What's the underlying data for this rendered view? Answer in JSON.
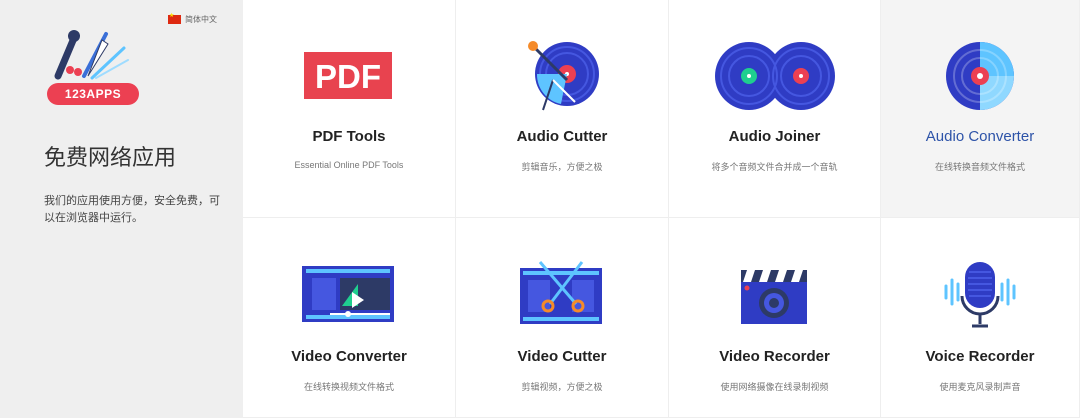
{
  "sidebar": {
    "language": "简体中文",
    "logo_text": "123APPS",
    "title": "免费网络应用",
    "description": "我们的应用使用方便，安全免费，可以在浏览器中运行。"
  },
  "apps": [
    {
      "title": "PDF Tools",
      "subtitle": "Essential Online PDF Tools",
      "icon": "pdf-icon",
      "icon_text": "PDF"
    },
    {
      "title": "Audio Cutter",
      "subtitle": "剪辑音乐，方便之极",
      "icon": "audio-cutter-icon"
    },
    {
      "title": "Audio Joiner",
      "subtitle": "将多个音频文件合并成一个音轨",
      "icon": "audio-joiner-icon"
    },
    {
      "title": "Audio Converter",
      "subtitle": "在线转换音频文件格式",
      "icon": "audio-converter-icon"
    },
    {
      "title": "Video Converter",
      "subtitle": "在线转换视频文件格式",
      "icon": "video-converter-icon"
    },
    {
      "title": "Video Cutter",
      "subtitle": "剪辑视频，方便之极",
      "icon": "video-cutter-icon"
    },
    {
      "title": "Video Recorder",
      "subtitle": "使用网络摄像在线录制视频",
      "icon": "video-recorder-icon"
    },
    {
      "title": "Voice Recorder",
      "subtitle": "使用麦克风录制声音",
      "icon": "microphone-icon"
    }
  ],
  "colors": {
    "accent_red": "#ec4052",
    "accent_blue": "#2d53a8",
    "sidebar_bg": "#efefef"
  }
}
